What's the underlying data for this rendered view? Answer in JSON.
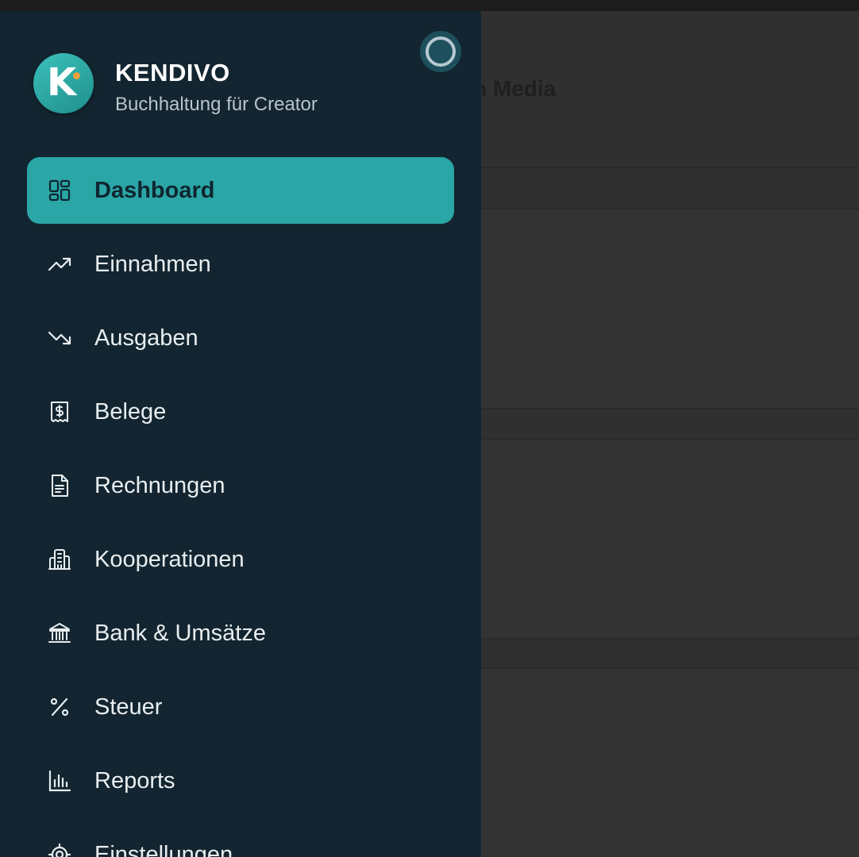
{
  "background": {
    "title_fragment": "n Media"
  },
  "brand": {
    "name": "KENDIVO",
    "subtitle": "Buchhaltung für Creator",
    "logo_letter": "K"
  },
  "sidebar": {
    "items": [
      {
        "label": "Dashboard",
        "icon": "dashboard-grid-icon",
        "active": true
      },
      {
        "label": "Einnahmen",
        "icon": "trending-up-icon"
      },
      {
        "label": "Ausgaben",
        "icon": "trending-down-icon"
      },
      {
        "label": "Belege",
        "icon": "receipt-icon"
      },
      {
        "label": "Rechnungen",
        "icon": "document-icon"
      },
      {
        "label": "Kooperationen",
        "icon": "building-icon"
      },
      {
        "label": "Bank & Umsätze",
        "icon": "bank-icon"
      },
      {
        "label": "Steuer",
        "icon": "percent-icon"
      },
      {
        "label": "Reports",
        "icon": "bar-chart-icon"
      },
      {
        "label": "Einstellungen",
        "icon": "gear-icon"
      }
    ]
  },
  "colors": {
    "sidebar_bg": "#132530",
    "active_bg": "#2ba6a6",
    "logo_accent": "#f2a23a",
    "overlay_bg": "#303030"
  }
}
